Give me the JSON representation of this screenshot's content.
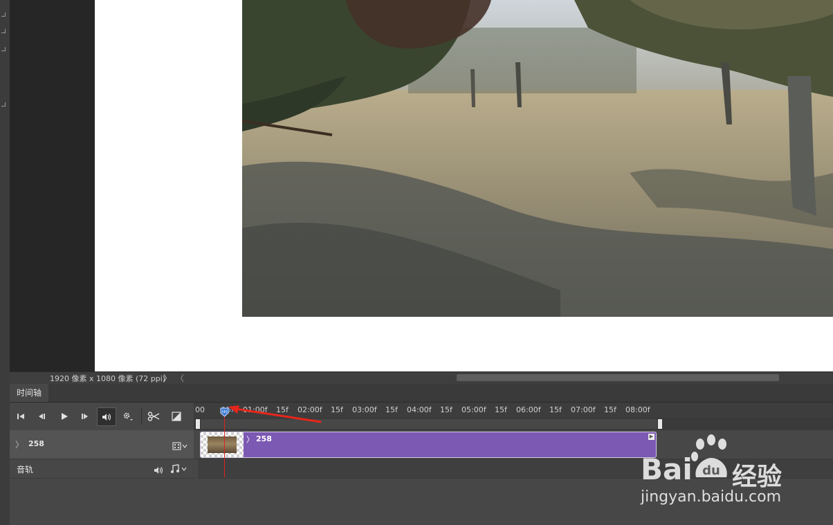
{
  "status_bar": {
    "document_size": "1920 像素 x 1080 像素 (72 ppi)",
    "arrow_right": "〉",
    "arrow_left": "〈"
  },
  "timeline": {
    "tab_label": "时间轴",
    "ruler_labels": [
      "00",
      "15f",
      "01:00f",
      "15f",
      "02:00f",
      "15f",
      "03:00f",
      "15f",
      "04:00f",
      "15f",
      "05:00f",
      "15f",
      "06:00f",
      "15f",
      "07:00f",
      "15f",
      "08:00f"
    ],
    "controls": {
      "go_to_first_frame": "go-to-first-frame-icon",
      "previous_frame": "previous-frame-icon",
      "play": "play-icon",
      "next_frame": "next-frame-icon",
      "audio": "speaker-icon",
      "settings": "gear-icon",
      "split": "scissors-icon",
      "transition": "transition-icon"
    },
    "video_track": {
      "name": "258",
      "clip_name": "258",
      "expand_glyph": "〉"
    },
    "audio_track": {
      "name": "音轨"
    },
    "playhead_color": "#e02020",
    "clip_color": "#7c59b3"
  },
  "watermark": {
    "brand": "Bai",
    "brand_suffix": "du",
    "cn": "经验",
    "url": "jingyan.baidu.com"
  }
}
